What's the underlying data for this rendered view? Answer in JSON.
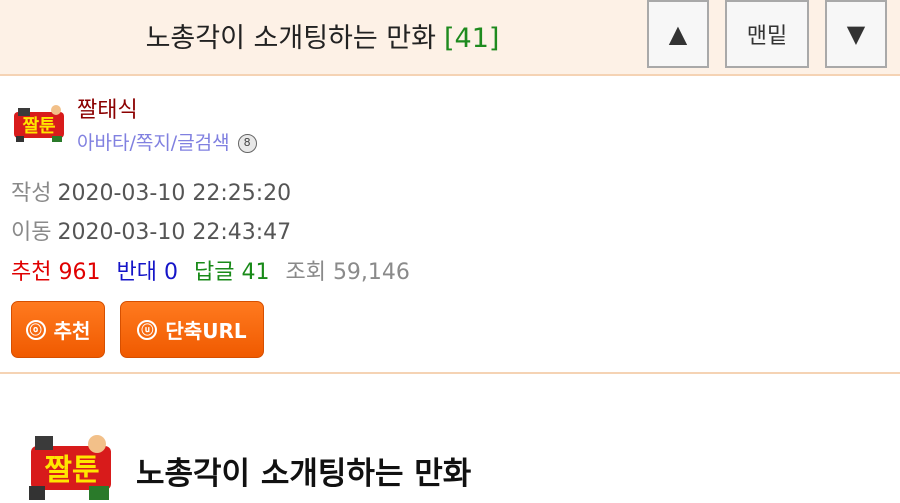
{
  "header": {
    "title": "노총각이 소개팅하는 만화",
    "comment_count": "[41]",
    "up_label": "▲",
    "bottom_label": "맨밑",
    "down_label": "▼"
  },
  "author": {
    "name": "짤태식",
    "links": "아바타/쪽지/글검색",
    "badge": "8"
  },
  "meta": {
    "written_label": "작성",
    "written_value": "2020-03-10 22:25:20",
    "moved_label": "이동",
    "moved_value": "2020-03-10 22:43:47"
  },
  "stats": {
    "recommend_label": "추천",
    "recommend_value": "961",
    "oppose_label": "반대",
    "oppose_value": "0",
    "reply_label": "답글",
    "reply_value": "41",
    "views_label": "조회",
    "views_value": "59,146"
  },
  "actions": {
    "recommend_icon": "ⓞ",
    "recommend_label": "추천",
    "shorturl_icon": "ⓤ",
    "shorturl_label": "단축URL"
  },
  "content": {
    "logo_text": "짤툰",
    "title": "노총각이 소개팅하는 만화"
  },
  "colors": {
    "header_bg": "#fdf1e6",
    "button_orange": "#f05a00",
    "recommend_red": "#e00000",
    "oppose_blue": "#1515c8",
    "reply_green": "#188a18"
  }
}
